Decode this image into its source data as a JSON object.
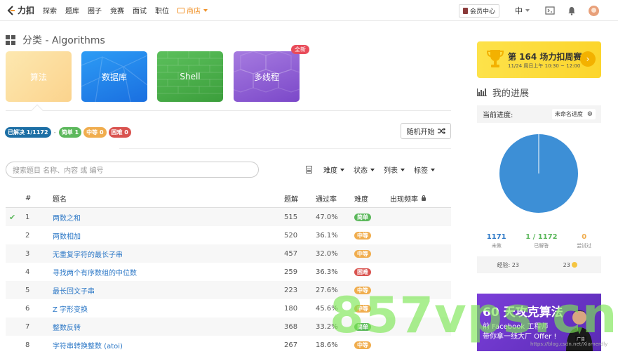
{
  "nav": {
    "logo": "力扣",
    "links": [
      "探索",
      "题库",
      "圈子",
      "竞赛",
      "面试",
      "职位"
    ],
    "shop": "商店",
    "vip": "会员中心",
    "lang": "中"
  },
  "category": {
    "title": "分类 - Algorithms",
    "tiles": [
      "算法",
      "数据库",
      "Shell",
      "多线程"
    ],
    "new_badge": "全新"
  },
  "summary": {
    "solved": "已解决 1/1172",
    "sep": "-",
    "easy": "简单 1",
    "medium": "中等 0",
    "hard": "困难 0"
  },
  "random_button": "随机开始",
  "search": {
    "placeholder": "搜索题目 名称、内容 或 编号"
  },
  "filters": [
    "难度",
    "状态",
    "列表",
    "标签"
  ],
  "table": {
    "headers": [
      "#",
      "题名",
      "题解",
      "通过率",
      "难度",
      "出现频率"
    ],
    "rows": [
      {
        "solved": true,
        "id": "1",
        "title": "两数之和",
        "solutions": "515",
        "rate": "47.0%",
        "difficulty": "简单",
        "level": "easy"
      },
      {
        "solved": false,
        "id": "2",
        "title": "两数相加",
        "solutions": "520",
        "rate": "36.1%",
        "difficulty": "中等",
        "level": "medium"
      },
      {
        "solved": false,
        "id": "3",
        "title": "无重复字符的最长子串",
        "solutions": "457",
        "rate": "32.0%",
        "difficulty": "中等",
        "level": "medium"
      },
      {
        "solved": false,
        "id": "4",
        "title": "寻找两个有序数组的中位数",
        "solutions": "259",
        "rate": "36.3%",
        "difficulty": "困难",
        "level": "hard"
      },
      {
        "solved": false,
        "id": "5",
        "title": "最长回文子串",
        "solutions": "223",
        "rate": "27.6%",
        "difficulty": "中等",
        "level": "medium"
      },
      {
        "solved": false,
        "id": "6",
        "title": "Z 字形变换",
        "solutions": "180",
        "rate": "45.6%",
        "difficulty": "中等",
        "level": "medium"
      },
      {
        "solved": false,
        "id": "7",
        "title": "整数反转",
        "solutions": "368",
        "rate": "33.2%",
        "difficulty": "简单",
        "level": "easy"
      },
      {
        "solved": false,
        "id": "8",
        "title": "字符串转换整数 (atoi)",
        "solutions": "267",
        "rate": "18.6%",
        "difficulty": "中等",
        "level": "medium"
      }
    ]
  },
  "contest": {
    "title": "第 164 场力扣周赛",
    "subtitle": "11/24 周日上午 10:30 ~ 12:00"
  },
  "progress": {
    "title": "我的进展",
    "current_label": "当前进度:",
    "session": "未命名进度",
    "unsolved": "1171",
    "unsolved_label": "未做",
    "solved": "1 / 1172",
    "solved_label": "已解答",
    "attempted": "0",
    "attempted_label": "尝试过",
    "exp": "经验: 23",
    "coins": "23",
    "solved_fraction": 0.00085
  },
  "ad": {
    "line1": "60 天攻克算法",
    "line2": "前 Facebook 工程师",
    "line3": "带你拿一线大厂 Offer !",
    "tag": "广告"
  },
  "watermark": "857vps.cn",
  "watermark2": "https://blog.csdn.net/Xiamerdly"
}
